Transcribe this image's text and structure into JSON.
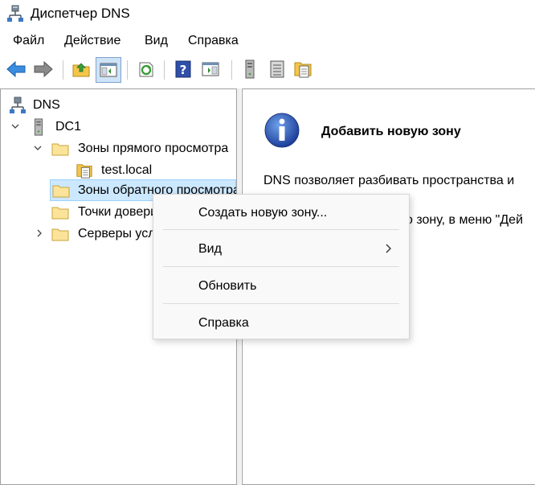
{
  "window": {
    "title": "Диспетчер DNS",
    "app_icon": "dns-manager-icon"
  },
  "menu": {
    "items": [
      {
        "label": "Файл"
      },
      {
        "label": "Действие"
      },
      {
        "label": "Вид"
      },
      {
        "label": "Справка"
      }
    ]
  },
  "toolbar": {
    "buttons": [
      {
        "icon": "back-arrow-icon"
      },
      {
        "icon": "forward-arrow-icon"
      },
      {
        "icon": "up-folder-icon"
      },
      {
        "icon": "show-hide-console-tree-icon",
        "pressed": true
      },
      {
        "icon": "refresh-icon"
      },
      {
        "icon": "help-icon"
      },
      {
        "icon": "show-hide-action-pane-icon"
      },
      {
        "icon": "server-icon"
      },
      {
        "icon": "list-view-icon"
      },
      {
        "icon": "zone-icon"
      }
    ]
  },
  "tree": {
    "nodes": [
      {
        "label": "DNS",
        "icon": "dns-icon"
      },
      {
        "label": "DC1",
        "icon": "server-icon",
        "expanded": true
      },
      {
        "label": "Зоны прямого просмотра",
        "icon": "folder-icon",
        "expanded": true
      },
      {
        "label": "test.local",
        "icon": "zone-file-icon"
      },
      {
        "label": "Зоны обратного просмотра",
        "icon": "folder-icon",
        "selected": true
      },
      {
        "label": "Точки доверия",
        "icon": "folder-icon"
      },
      {
        "label": "Серверы условной пересылки",
        "icon": "folder-icon",
        "expanded": false
      }
    ]
  },
  "right_pane": {
    "heading": "Добавить новую зону",
    "text_line1": "DNS позволяет разбивать пространства и",
    "text_line2": "о зону, в меню \"Дей",
    "icon": "info-icon"
  },
  "context_menu": {
    "items": [
      {
        "label": "Создать новую зону..."
      },
      {
        "label": "Вид",
        "submenu": true
      },
      {
        "label": "Обновить"
      },
      {
        "label": "Справка"
      }
    ]
  },
  "colors": {
    "selection_bg": "#cce8ff",
    "selection_border": "#99d1ff",
    "pane_border": "#a0a0a0",
    "menu_bg": "#f9f9f9"
  }
}
